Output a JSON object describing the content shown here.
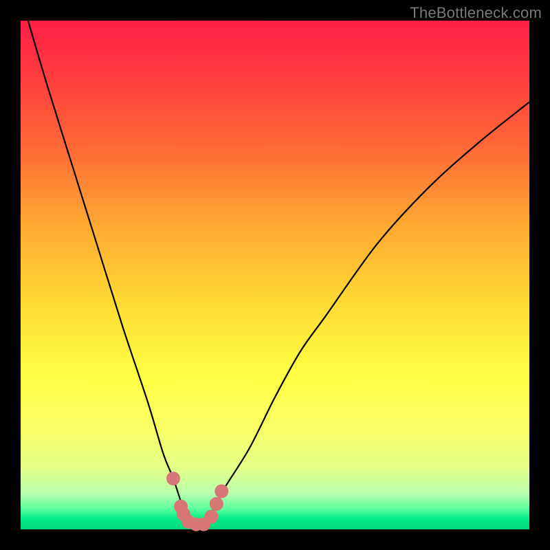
{
  "watermark": "TheBottleneck.com",
  "chart_data": {
    "type": "line",
    "title": "",
    "xlabel": "",
    "ylabel": "",
    "xlim": [
      0,
      100
    ],
    "ylim": [
      0,
      100
    ],
    "series": [
      {
        "name": "bottleneck-curve",
        "x": [
          0,
          5,
          10,
          15,
          20,
          25,
          28,
          30,
          32,
          33,
          34,
          35,
          36,
          38,
          40,
          45,
          50,
          55,
          60,
          70,
          80,
          90,
          100
        ],
        "values": [
          105,
          88,
          72,
          56,
          40,
          25,
          15,
          10,
          4,
          2,
          1,
          1,
          2,
          4,
          8,
          16,
          26,
          35,
          42,
          56,
          67,
          76,
          84
        ]
      }
    ],
    "highlight": {
      "name": "bottom-marker",
      "points": [
        {
          "x": 30.0,
          "y": 10.0
        },
        {
          "x": 31.5,
          "y": 4.5
        },
        {
          "x": 32.0,
          "y": 3.0
        },
        {
          "x": 33.0,
          "y": 1.5
        },
        {
          "x": 34.5,
          "y": 1.0
        },
        {
          "x": 36.0,
          "y": 1.0
        },
        {
          "x": 37.5,
          "y": 2.5
        },
        {
          "x": 38.5,
          "y": 5.0
        },
        {
          "x": 39.5,
          "y": 7.5
        }
      ],
      "color": "#d87676",
      "radius": 10
    },
    "curve_color": "#000000",
    "curve_width": 2.2
  }
}
